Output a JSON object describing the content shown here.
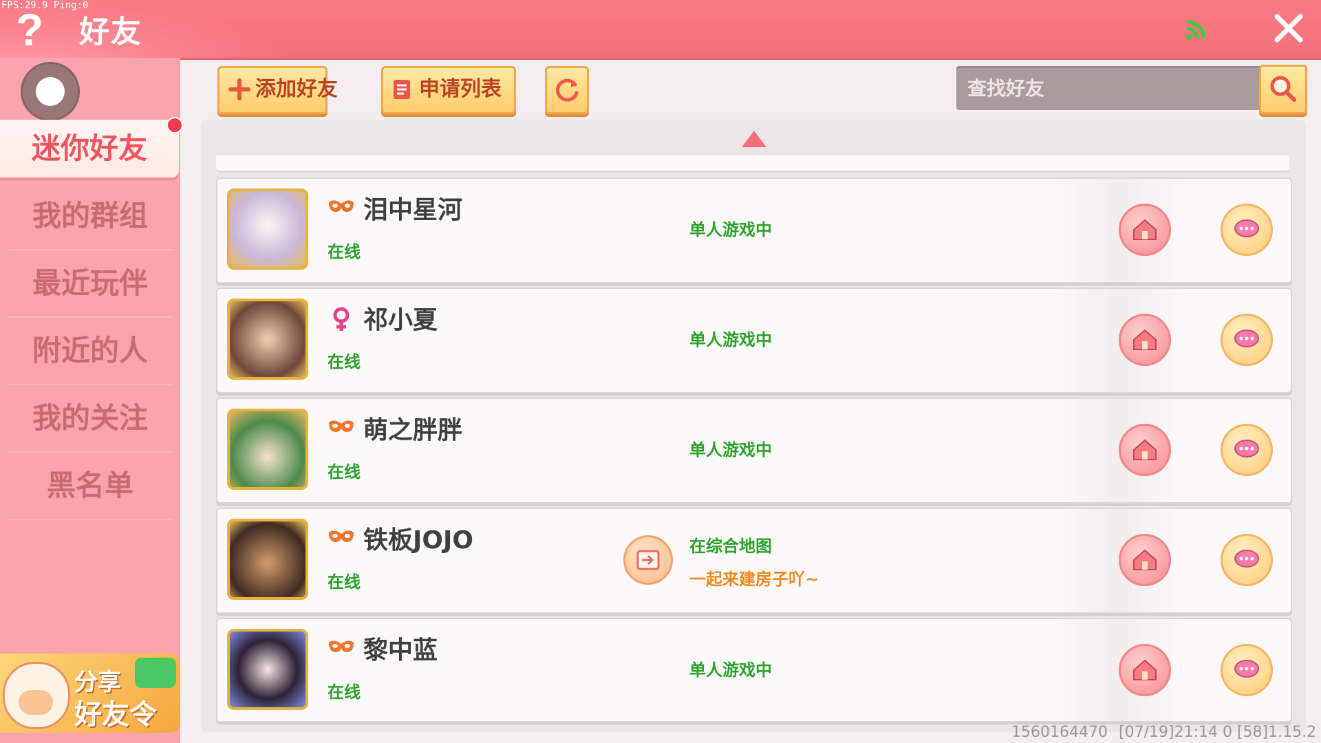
{
  "debug": {
    "fps_text": "FPS:29.9  Ping:0"
  },
  "header": {
    "title": "好友",
    "help_icon": "question-mark-icon",
    "signal_icon": "signal-icon",
    "close_icon": "close-icon"
  },
  "sidebar": {
    "items": [
      {
        "label": "迷你好友",
        "active": true
      },
      {
        "label": "我的群组"
      },
      {
        "label": "最近玩伴"
      },
      {
        "label": "附近的人"
      },
      {
        "label": "我的关注"
      },
      {
        "label": "黑名单"
      }
    ],
    "share": {
      "line1": "分享",
      "line2": "好友令"
    }
  },
  "toolbar": {
    "add_friend": "添加好友",
    "apply_list": "申请列表",
    "search_placeholder": "查找好友"
  },
  "friends": [
    {
      "name": "泪中星河",
      "gender_icon": "mask-icon",
      "online": "在线",
      "status": "单人游戏中"
    },
    {
      "name": "祁小夏",
      "gender_icon": "female-icon",
      "online": "在线",
      "status": "单人游戏中"
    },
    {
      "name": "萌之胖胖",
      "gender_icon": "mask-icon",
      "online": "在线",
      "status": "单人游戏中"
    },
    {
      "name": "铁板JOJO",
      "gender_icon": "mask-icon",
      "online": "在线",
      "status": "在综合地图",
      "substatus": "一起来建房子吖~"
    },
    {
      "name": "黎中蓝",
      "gender_icon": "mask-icon",
      "online": "在线",
      "status": "单人游戏中"
    }
  ],
  "footer": {
    "user_id": "1560164470",
    "version": "[07/19]21:14 0  [58]1.15.2"
  },
  "colors": {
    "header": "#f5707c",
    "sidebar": "#f9a4ad",
    "online_green": "#2aa12a",
    "accent_orange": "#f08a1d"
  }
}
